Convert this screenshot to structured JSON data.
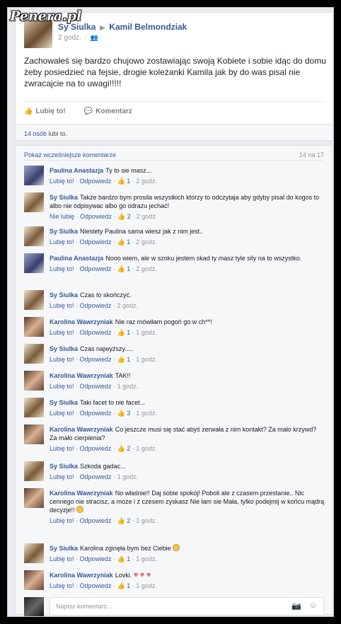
{
  "watermark": "Penera.pl",
  "post": {
    "author": "Sy Siulka",
    "target": "Kamil Belmondziak",
    "time": "2 godz.",
    "text": "Zachowałeś się bardzo chujowo zostawiając swoją Kobiete i sobie idąc do domu żeby posiedzieć na fejsie, drogie koleżanki Kamila jak by do was pisal nie zwracajcie na to uwagi!!!!!",
    "like_label": "Lubię to!",
    "comment_label": "Komentarz"
  },
  "likes": {
    "count": "14 osób",
    "suffix": "lubi to."
  },
  "comments_header": {
    "prev": "Pokaż wcześniejsze komentarze",
    "pages": "14 na 17"
  },
  "comments": [
    {
      "author": "Paulina Anastazja",
      "text": "Ty to sie masz...",
      "like": "Lubię to!",
      "reply": "Odpowiedz",
      "likes": "1",
      "time": "2 godz.",
      "avatar": "paulina"
    },
    {
      "author": "Sy Siulka",
      "text": "Także bardzo bym prosila wszystkich ktorzy to odczytaja aby gdyby pisal do kogos to albo nie odpisywac albo go odrazu jechać!",
      "like": "Nie lubię",
      "reply": "Odpowiedz",
      "likes": "2",
      "time": "2 godz.",
      "avatar": "sy"
    },
    {
      "author": "Sy Siulka",
      "text": "Niestety Paulina sama wiesz jak z nim jest..",
      "like": "Lubię to!",
      "reply": "Odpowiedz",
      "likes": "1",
      "time": "2 godz.",
      "avatar": "sy"
    },
    {
      "author": "Paulina Anastazja",
      "text": "Nooo wiem, ale w szoku jestem skad ty masz tyle sily na to wszystko.",
      "like": "Lubię to!",
      "reply": "Odpowiedz",
      "likes": "1",
      "time": "2 godz.",
      "avatar": "paulina"
    },
    {
      "author": "Sy Siulka",
      "text": "Czas to skończyć.",
      "like": "Lubię to!",
      "reply": "Odpowiedz",
      "likes": "",
      "time": "2 godz.",
      "avatar": "sy"
    },
    {
      "author": "Karolina Wawrzyniak",
      "text": "Nie raz mówiłam pogoń go w ch**!",
      "like": "Lubię to!",
      "reply": "Odpowiedz",
      "likes": "1",
      "time": "1 godz.",
      "avatar": "karolina"
    },
    {
      "author": "Sy Siulka",
      "text": "Czas najwyższy.....",
      "like": "Lubię to!",
      "reply": "Odpowiedz",
      "likes": "1",
      "time": "1 godz.",
      "avatar": "sy"
    },
    {
      "author": "Karolina Wawrzyniak",
      "text": "TAK!!",
      "like": "Lubię to!",
      "reply": "Odpowiedz",
      "likes": "",
      "time": "1 godz.",
      "avatar": "karolina"
    },
    {
      "author": "Sy Siulka",
      "text": "Taki facet to nie facet...",
      "like": "Lubię to!",
      "reply": "Odpowiedz",
      "likes": "3",
      "time": "1 godz.",
      "avatar": "sy"
    },
    {
      "author": "Karolina Wawrzyniak",
      "text": "Co jeszcze musi się stać abyś zerwała z nim kontakt? Za mało krzywd? Za mało cierpienia?",
      "like": "Lubię to!",
      "reply": "Odpowiedz",
      "likes": "2",
      "time": "1 godz.",
      "avatar": "karolina"
    },
    {
      "author": "Sy Siulka",
      "text": "Szkoda gadac...",
      "like": "Lubię to!",
      "reply": "Odpowiedz",
      "likes": "",
      "time": "1 godz.",
      "avatar": "sy"
    },
    {
      "author": "Karolina Wawrzyniak",
      "text": "No właśnie!! Daj sobie spokój! Poboli ale z czasem przestanie.. Nic cennego nie stracisz, a może i z czesem zyskasz  Nie łam sie Mała, tylko podejmij w końcu mądrą decyzje!! ",
      "like": "Lubię to!",
      "reply": "Odpowiedz",
      "likes": "2",
      "time": "1 godz.",
      "avatar": "karolina"
    },
    {
      "author": "Sy Siulka",
      "text": "Karolina zginęła bym bez Ciebie ",
      "like": "Lubię to!",
      "reply": "Odpowiedz",
      "likes": "1",
      "time": "1 godz.",
      "avatar": "sy"
    },
    {
      "author": "Karolina Wawrzyniak",
      "text": "Lovki. ♥ ♥ ♥",
      "like": "Lubię to!",
      "reply": "Odpowiedz",
      "likes": "1",
      "time": "1 godz.",
      "avatar": "karolina"
    }
  ],
  "composer": {
    "placeholder": "Napisz komentarz..."
  }
}
